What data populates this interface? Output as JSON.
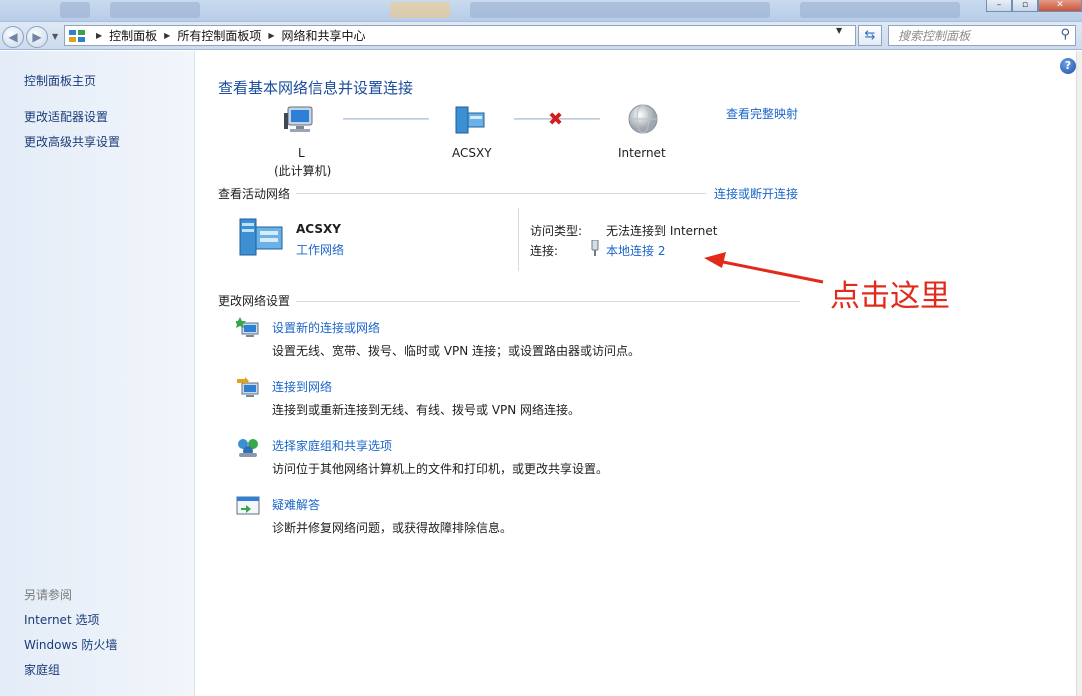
{
  "address_bar": {
    "breadcrumbs": [
      "控制面板",
      "所有控制面板项",
      "网络和共享中心"
    ],
    "search_placeholder": "搜索控制面板"
  },
  "sidebar": {
    "home": "控制面板主页",
    "tasks": [
      "更改适配器设置",
      "更改高级共享设置"
    ],
    "see_also_heading": "另请参阅",
    "see_also": [
      "Internet 选项",
      "Windows 防火墙",
      "家庭组"
    ]
  },
  "main": {
    "title": "查看基本网络信息并设置连接",
    "view_full_map": "查看完整映射",
    "map": {
      "computer_name": "L",
      "computer_sub": "(此计算机)",
      "network_name": "ACSXY",
      "internet": "Internet"
    },
    "active_networks_heading": "查看活动网络",
    "connect_disconnect": "连接或断开连接",
    "active_network": {
      "name": "ACSXY",
      "type": "工作网络",
      "access_type_label": "访问类型:",
      "access_type_value": "无法连接到 Internet",
      "connections_label": "连接:",
      "connections_value": "本地连接 2"
    },
    "change_settings_heading": "更改网络设置",
    "tasks": [
      {
        "title": "设置新的连接或网络",
        "desc": "设置无线、宽带、拨号、临时或 VPN 连接；或设置路由器或访问点。"
      },
      {
        "title": "连接到网络",
        "desc": "连接到或重新连接到无线、有线、拨号或 VPN 网络连接。"
      },
      {
        "title": "选择家庭组和共享选项",
        "desc": "访问位于其他网络计算机上的文件和打印机，或更改共享设置。"
      },
      {
        "title": "疑难解答",
        "desc": "诊断并修复网络问题，或获得故障排除信息。"
      }
    ]
  },
  "annotation": {
    "text": "点击这里",
    "color": "#e22a1a"
  },
  "colors": {
    "link": "#1b66c9",
    "title": "#1a4b9c",
    "sidebar_link": "#1a3c78",
    "error_x": "#d01e1e"
  }
}
